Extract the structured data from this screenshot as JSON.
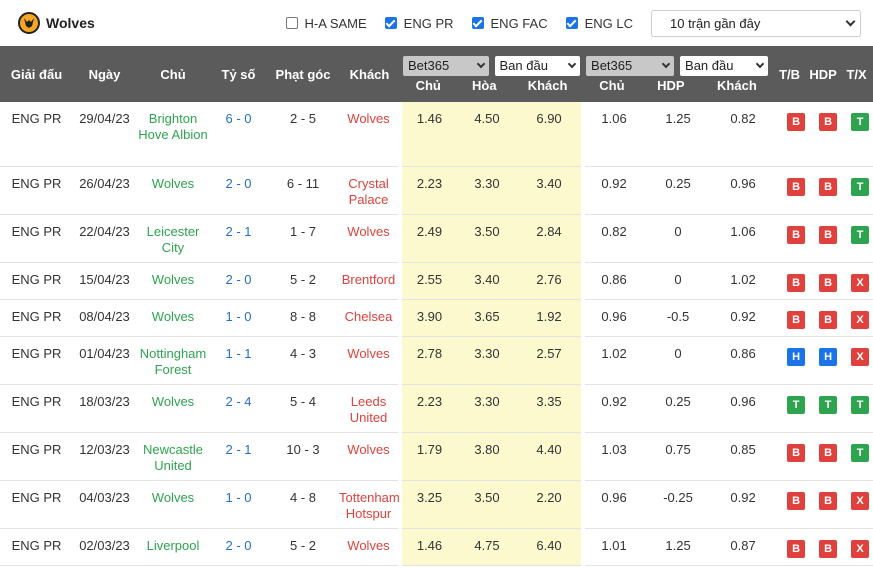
{
  "header": {
    "team": "Wolves",
    "filters": [
      {
        "label": "H-A SAME",
        "checked": false
      },
      {
        "label": "ENG PR",
        "checked": true
      },
      {
        "label": "ENG FAC",
        "checked": true
      },
      {
        "label": "ENG LC",
        "checked": true
      }
    ],
    "range_select": "10 trận gần đây"
  },
  "columns": {
    "league": "Giải đấu",
    "date": "Ngày",
    "home": "Chủ",
    "score": "Tỷ số",
    "corners": "Phạt góc",
    "away": "Khách",
    "odds1_book": "Bet365",
    "odds1_type": "Ban đầu",
    "odds1_home": "Chủ",
    "odds1_draw": "Hòa",
    "odds1_away": "Khách",
    "odds2_book": "Bet365",
    "odds2_type": "Ban đầu",
    "odds2_home": "Chủ",
    "odds2_hdp": "HDP",
    "odds2_away": "Khách",
    "tb": "T/B",
    "hdp": "HDP",
    "tx": "T/X"
  },
  "colors": {
    "green": "#2ea44f",
    "red": "#e0413c",
    "blue": "#1a73e8",
    "header_bg": "#5b5b5b",
    "highlight": "#fcf9cf"
  },
  "rows": [
    {
      "league": "ENG PR",
      "date": "29/04/23",
      "home": "Brighton Hove Albion",
      "home_color": "green",
      "score": "6 - 0",
      "corners": "2 - 5",
      "away": "Wolves",
      "away_color": "red",
      "o1h": "1.46",
      "o1d": "4.50",
      "o1a": "6.90",
      "o2h": "1.06",
      "o2hdp": "1.25",
      "o2a": "0.82",
      "r1": "B",
      "r2": "B",
      "r3": "T"
    },
    {
      "league": "ENG PR",
      "date": "26/04/23",
      "home": "Wolves",
      "home_color": "green",
      "score": "2 - 0",
      "corners": "6 - 11",
      "away": "Crystal Palace",
      "away_color": "red",
      "o1h": "2.23",
      "o1d": "3.30",
      "o1a": "3.40",
      "o2h": "0.92",
      "o2hdp": "0.25",
      "o2a": "0.96",
      "r1": "B",
      "r2": "B",
      "r3": "T"
    },
    {
      "league": "ENG PR",
      "date": "22/04/23",
      "home": "Leicester City",
      "home_color": "green",
      "score": "2 - 1",
      "corners": "1 - 7",
      "away": "Wolves",
      "away_color": "red",
      "o1h": "2.49",
      "o1d": "3.50",
      "o1a": "2.84",
      "o2h": "0.82",
      "o2hdp": "0",
      "o2a": "1.06",
      "r1": "B",
      "r2": "B",
      "r3": "T"
    },
    {
      "league": "ENG PR",
      "date": "15/04/23",
      "home": "Wolves",
      "home_color": "green",
      "score": "2 - 0",
      "corners": "5 - 2",
      "away": "Brentford",
      "away_color": "red",
      "o1h": "2.55",
      "o1d": "3.40",
      "o1a": "2.76",
      "o2h": "0.86",
      "o2hdp": "0",
      "o2a": "1.02",
      "r1": "B",
      "r2": "B",
      "r3": "X"
    },
    {
      "league": "ENG PR",
      "date": "08/04/23",
      "home": "Wolves",
      "home_color": "green",
      "score": "1 - 0",
      "corners": "8 - 8",
      "away": "Chelsea",
      "away_color": "red",
      "o1h": "3.90",
      "o1d": "3.65",
      "o1a": "1.92",
      "o2h": "0.96",
      "o2hdp": "-0.5",
      "o2a": "0.92",
      "r1": "B",
      "r2": "B",
      "r3": "X"
    },
    {
      "league": "ENG PR",
      "date": "01/04/23",
      "home": "Nottingham Forest",
      "home_color": "green",
      "score": "1 - 1",
      "corners": "4 - 3",
      "away": "Wolves",
      "away_color": "red",
      "o1h": "2.78",
      "o1d": "3.30",
      "o1a": "2.57",
      "o2h": "1.02",
      "o2hdp": "0",
      "o2a": "0.86",
      "r1": "H",
      "r2": "H",
      "r3": "X"
    },
    {
      "league": "ENG PR",
      "date": "18/03/23",
      "home": "Wolves",
      "home_color": "green",
      "score": "2 - 4",
      "corners": "5 - 4",
      "away": "Leeds United",
      "away_color": "red",
      "o1h": "2.23",
      "o1d": "3.30",
      "o1a": "3.35",
      "o2h": "0.92",
      "o2hdp": "0.25",
      "o2a": "0.96",
      "r1": "T",
      "r2": "T",
      "r3": "T"
    },
    {
      "league": "ENG PR",
      "date": "12/03/23",
      "home": "Newcastle United",
      "home_color": "green",
      "score": "2 - 1",
      "corners": "10 - 3",
      "away": "Wolves",
      "away_color": "red",
      "o1h": "1.79",
      "o1d": "3.80",
      "o1a": "4.40",
      "o2h": "1.03",
      "o2hdp": "0.75",
      "o2a": "0.85",
      "r1": "B",
      "r2": "B",
      "r3": "T"
    },
    {
      "league": "ENG PR",
      "date": "04/03/23",
      "home": "Wolves",
      "home_color": "green",
      "score": "1 - 0",
      "corners": "4 - 8",
      "away": "Tottenham Hotspur",
      "away_color": "red",
      "o1h": "3.25",
      "o1d": "3.50",
      "o1a": "2.20",
      "o2h": "0.96",
      "o2hdp": "-0.25",
      "o2a": "0.92",
      "r1": "B",
      "r2": "B",
      "r3": "X"
    },
    {
      "league": "ENG PR",
      "date": "02/03/23",
      "home": "Liverpool",
      "home_color": "green",
      "score": "2 - 0",
      "corners": "5 - 2",
      "away": "Wolves",
      "away_color": "red",
      "o1h": "1.46",
      "o1d": "4.75",
      "o1a": "6.40",
      "o2h": "1.01",
      "o2hdp": "1.25",
      "o2a": "0.87",
      "r1": "B",
      "r2": "B",
      "r3": "X"
    }
  ]
}
